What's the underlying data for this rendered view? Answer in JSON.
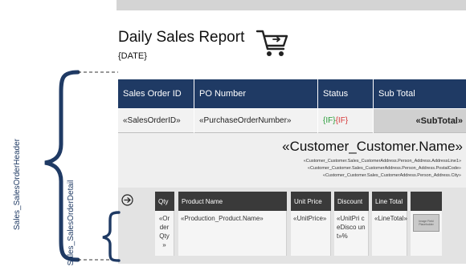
{
  "report": {
    "title": "Daily Sales Report",
    "date_placeholder": "{DATE}"
  },
  "header_table": {
    "columns": [
      "Sales Order ID",
      "PO Number",
      "Status",
      "Sub Total"
    ],
    "row": {
      "sales_order_id": "«SalesOrderID»",
      "po_number": "«PurchaseOrderNumber»",
      "status_if": "{IF}",
      "status_if2": "{IF}",
      "subtotal": "«SubTotal»"
    }
  },
  "customer": {
    "name": "«Customer_Customer.Name»",
    "address_lines": [
      "«Customer_Customer.Sales_CustomerAddress.Person_Address.AddressLine1»",
      "«Customer_Customer.Sales_CustomerAddress.Person_Address.PostalCode»",
      "«Customer_Customer.Sales_CustomerAddress.Person_Address.City»"
    ]
  },
  "detail_table": {
    "columns": [
      "Qty",
      "Product Name",
      "Unit Price",
      "Discount",
      "Line Total",
      ""
    ],
    "row": {
      "qty": "«Or der Qty »",
      "product_name": "«Production_Product.Name»",
      "unit_price": "«UnitPrice»",
      "discount": "«UnitPri ceDisco unt»%",
      "line_total": "«LineTotal»",
      "thumbnail_text": "Image Field Placeholder"
    }
  },
  "annotations": {
    "header_label": "Sales_SalesOrderHeader",
    "detail_label": "Sales_SalesOrderDetail"
  },
  "colors": {
    "header_blue": "#1f3a64",
    "detail_header": "#3a3a3a",
    "if_green": "#2a9d3a",
    "if_red": "#d63a3a"
  },
  "icons": [
    "shopping-cart-icon",
    "arrow-right-circle-icon",
    "curly-brace-icon"
  ]
}
